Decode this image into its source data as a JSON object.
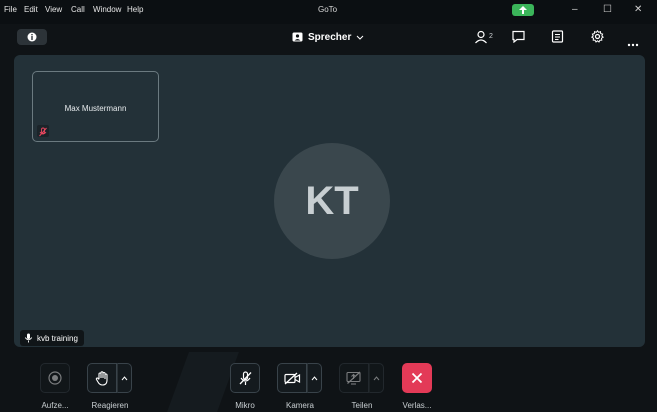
{
  "menubar": {
    "items": [
      "File",
      "Edit",
      "View",
      "Call",
      "Window",
      "Help"
    ],
    "app_title": "GoTo",
    "window_controls": [
      "minimize-icon",
      "maximize-icon",
      "close-icon"
    ],
    "window_glyphs": {
      "minimize": "–",
      "maximize": "☐",
      "close": "✕"
    }
  },
  "toolbar": {
    "view_mode": "Sprecher",
    "participant_count": "2"
  },
  "stage": {
    "tile_name": "Max Mustermann",
    "avatar_initials": "KT",
    "speaker_name": "kvb training"
  },
  "controls": {
    "record_label": "Aufze...",
    "react_label": "Reagieren",
    "mic_label": "Mikro",
    "camera_label": "Kamera",
    "share_label": "Teilen",
    "leave_label": "Verlas..."
  },
  "colors": {
    "stage_background": "#233138",
    "leave_red": "#e33a57",
    "mute_red": "#e8475f",
    "status_green": "#3bb55a"
  }
}
